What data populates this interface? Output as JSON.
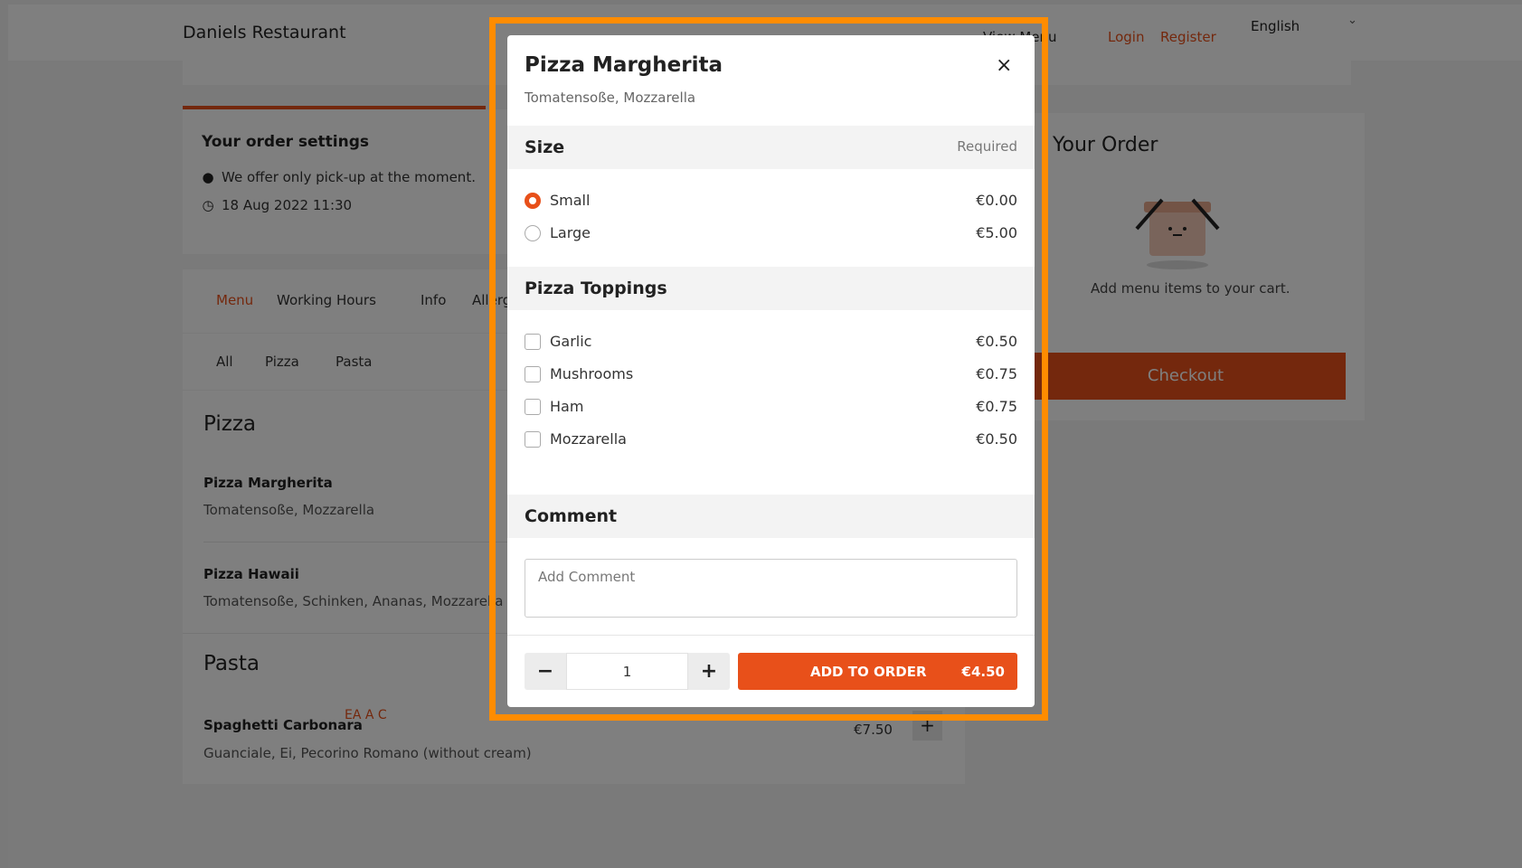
{
  "header": {
    "brand": "Daniels Restaurant",
    "view_menu": "View Menu",
    "login": "Login",
    "register": "Register",
    "language": "English"
  },
  "order_settings": {
    "title": "Your order settings",
    "pickup_note": "We offer only pick-up at the moment.",
    "datetime": "18 Aug 2022 11:30"
  },
  "tabs": [
    "Menu",
    "Working Hours",
    "Info",
    "Allergens"
  ],
  "filters": [
    "All",
    "Pizza",
    "Pasta"
  ],
  "menu": {
    "pizza_heading": "Pizza",
    "pasta_heading": "Pasta",
    "items": [
      {
        "name": "Pizza Margherita",
        "desc": "Tomatensoße, Mozzarella"
      },
      {
        "name": "Pizza Hawaii",
        "desc": "Tomatensoße, Schinken, Ananas, Mozzarella"
      },
      {
        "name": "Spaghetti Carbonara",
        "allergens": "EA A C",
        "desc": "Guanciale, Ei, Pecorino Romano (without cream)",
        "price": "€7.50"
      }
    ]
  },
  "cart": {
    "title": "Your Order",
    "empty_text": "Add menu items to your cart.",
    "checkout": "Checkout"
  },
  "modal": {
    "title": "Pizza Margherita",
    "subtitle": "Tomatensoße, Mozzarella",
    "close": "×",
    "size_title": "Size",
    "size_required": "Required",
    "sizes": [
      {
        "label": "Small",
        "price": "€0.00",
        "selected": true
      },
      {
        "label": "Large",
        "price": "€5.00",
        "selected": false
      }
    ],
    "toppings_title": "Pizza Toppings",
    "toppings": [
      {
        "label": "Garlic",
        "price": "€0.50"
      },
      {
        "label": "Mushrooms",
        "price": "€0.75"
      },
      {
        "label": "Ham",
        "price": "€0.75"
      },
      {
        "label": "Mozzarella",
        "price": "€0.50"
      }
    ],
    "comment_title": "Comment",
    "comment_placeholder": "Add Comment",
    "quantity": "1",
    "minus": "−",
    "plus": "+",
    "add_label": "ADD TO ORDER",
    "add_price": "€4.50"
  },
  "colors": {
    "accent": "#e8501a",
    "focus_border": "#ff8c00"
  }
}
